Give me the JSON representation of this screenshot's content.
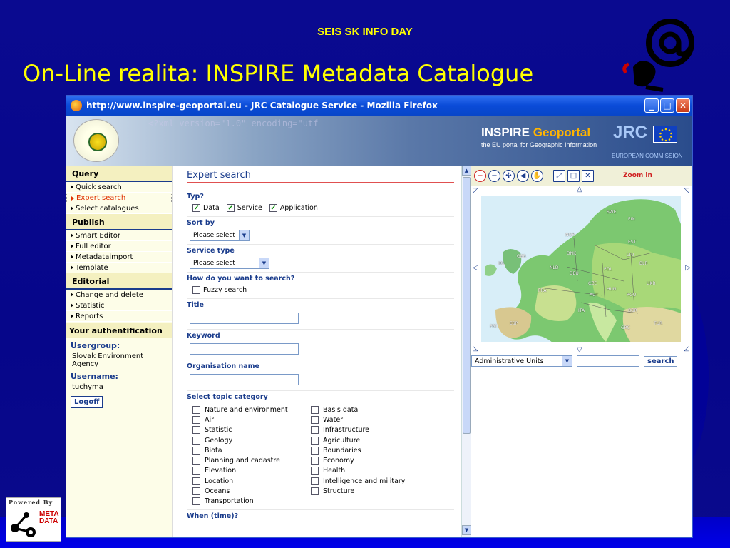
{
  "slide": {
    "header": "SEIS SK INFO DAY",
    "title": "On-Line realita: INSPIRE Metadata Catalogue",
    "powered_by": "Powered By",
    "powered_logo": "META DATA"
  },
  "browser": {
    "window_title": "http://www.inspire-geoportal.eu - JRC Catalogue Service - Mozilla Firefox",
    "banner": {
      "xml_bg_text": "<?xml version=\"1.0\" encoding=\"utf",
      "inspire_a": "INSPIRE",
      "inspire_b": "Geoportal",
      "inspire_sub": "the EU portal for Geographic Information",
      "jrc": "JRC",
      "ec": "EUROPEAN COMMISSION"
    }
  },
  "sidebar": {
    "query_head": "Query",
    "query_items": [
      "Quick search",
      "Expert search",
      "Select catalogues"
    ],
    "publish_head": "Publish",
    "publish_items": [
      "Smart Editor",
      "Full editor",
      "Metadataimport",
      "Template"
    ],
    "editorial_head": "Editorial",
    "editorial_items": [
      "Change and delete",
      "Statistic",
      "Reports"
    ],
    "auth_head": "Your authentification",
    "usergroup_label": "Usergroup:",
    "usergroup_value": "Slovak Environment Agency",
    "username_label": "Username:",
    "username_value": "tuchyma",
    "logoff": "Logoff"
  },
  "main": {
    "title": "Expert search",
    "typ_label": "Typ?",
    "typ_options": [
      "Data",
      "Service",
      "Application"
    ],
    "sort_label": "Sort by",
    "sort_value": "Please select",
    "service_type_label": "Service type",
    "service_type_value": "Please select",
    "how_label": "How do you want to search?",
    "fuzzy_label": "Fuzzy search",
    "title_label": "Title",
    "keyword_label": "Keyword",
    "org_label": "Organisation name",
    "topic_label": "Select topic category",
    "topics_left": [
      "Nature and environment",
      "Air",
      "Statistic",
      "Geology",
      "Biota",
      "Planning and cadastre",
      "Elevation",
      "Location",
      "Oceans",
      "Transportation"
    ],
    "topics_right": [
      "Basis data",
      "Water",
      "Infrastructure",
      "Agriculture",
      "Boundaries",
      "Economy",
      "Health",
      "Intelligence and military",
      "Structure"
    ],
    "when_label": "When (time)?"
  },
  "map": {
    "zoom_label": "Zoom in",
    "layer_select": "Administrative Units",
    "search_button": "search",
    "countries": [
      "SWE",
      "FIN",
      "NOR",
      "EST",
      "DNK",
      "LTU",
      "IRL",
      "GBR",
      "BLR",
      "NLD",
      "DEU",
      "POL",
      "FRA",
      "CZE",
      "UKR",
      "AUT",
      "HUN",
      "ROU",
      "ITA",
      "BGR",
      "PRT",
      "ESP",
      "GRC",
      "TUR"
    ]
  },
  "colors": {
    "slide_bg": "#0a0a8c",
    "title_yellow": "#ffff00",
    "link_blue": "#1a3c8c",
    "active_red": "#e03000"
  }
}
